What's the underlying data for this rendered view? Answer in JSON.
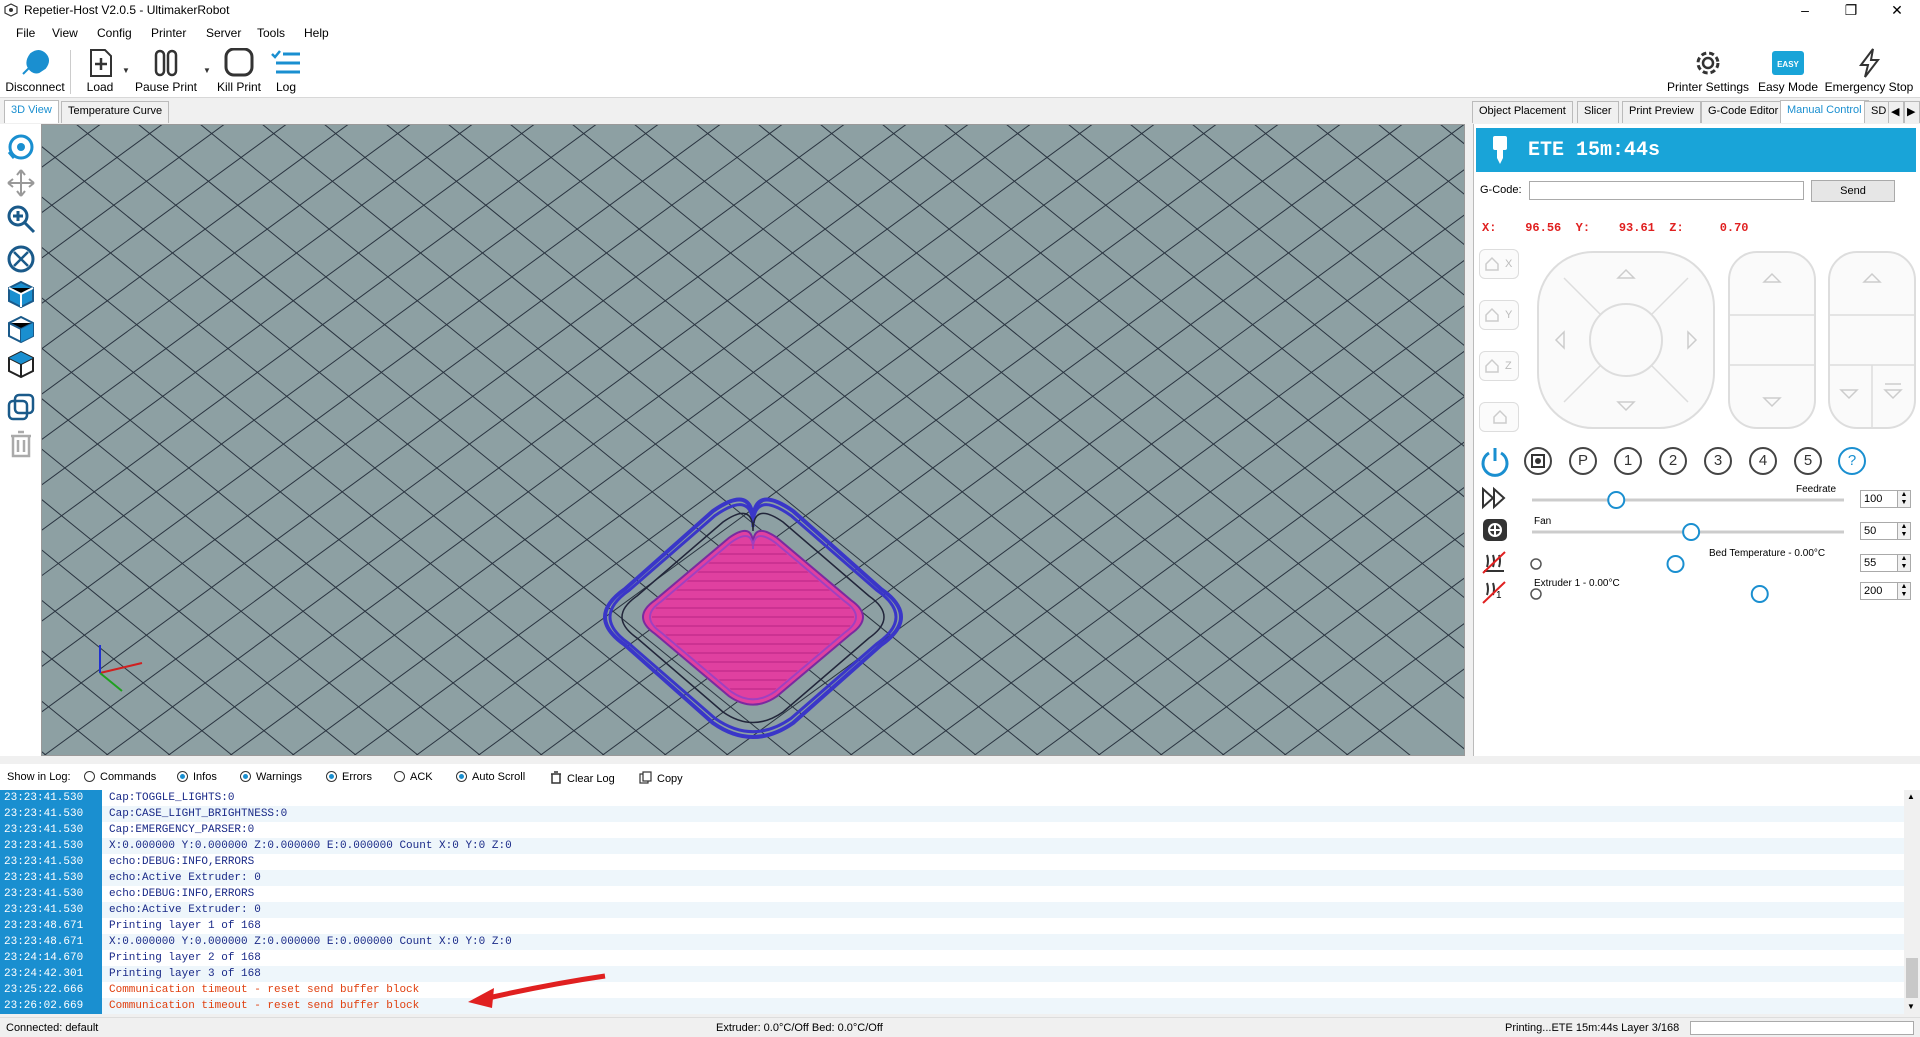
{
  "window": {
    "title": "Repetier-Host V2.0.5 - UltimakerRobot"
  },
  "menu": [
    "File",
    "View",
    "Config",
    "Printer",
    "Server",
    "Tools",
    "Help"
  ],
  "toolbar": {
    "disconnect": "Disconnect",
    "load": "Load",
    "pause": "Pause Print",
    "kill": "Kill Print",
    "log": "Log",
    "printer_settings": "Printer Settings",
    "easy_mode": "Easy Mode",
    "easy_badge": "EASY",
    "emergency_stop": "Emergency Stop"
  },
  "left_tabs": [
    "3D View",
    "Temperature Curve"
  ],
  "right_tabs": [
    "Object Placement",
    "Slicer",
    "Print Preview",
    "G-Code Editor",
    "Manual Control",
    "SD"
  ],
  "manual": {
    "ete": "ETE 15m:44s",
    "gcode_label": "G-Code:",
    "gcode_value": "",
    "send": "Send",
    "x_label": "X:",
    "x": "96.56",
    "y_label": "Y:",
    "y": "93.61",
    "z_label": "Z:",
    "z": "0.70",
    "home_labels": [
      "X",
      "Y",
      "Z",
      ""
    ],
    "buttons": [
      "P",
      "1",
      "2",
      "3",
      "4",
      "5",
      "?"
    ],
    "feedrate_label": "Feedrate",
    "feedrate_value": "100",
    "fan_label": "Fan",
    "fan_value": "50",
    "bed_label": "Bed Temperature - 0.00°C",
    "bed_value": "55",
    "extruder_label": "Extruder 1 - 0.00°C",
    "extruder_value": "200",
    "extruder_index": "1"
  },
  "sliders": {
    "feedrate": 0.27,
    "fan": 0.51,
    "bed": 0.46,
    "extruder": 0.73
  },
  "log_options": {
    "show_in_log": "Show in Log:",
    "commands": "Commands",
    "commands_on": false,
    "infos": "Infos",
    "infos_on": true,
    "warnings": "Warnings",
    "warnings_on": true,
    "errors": "Errors",
    "errors_on": true,
    "ack": "ACK",
    "ack_on": false,
    "auto_scroll": "Auto Scroll",
    "auto_scroll_on": true,
    "clear_log": "Clear Log",
    "copy": "Copy"
  },
  "log": [
    {
      "time": "23:23:41.530",
      "msg": "Cap:TOGGLE_LIGHTS:0",
      "type": "info"
    },
    {
      "time": "23:23:41.530",
      "msg": "Cap:CASE_LIGHT_BRIGHTNESS:0",
      "type": "info"
    },
    {
      "time": "23:23:41.530",
      "msg": "Cap:EMERGENCY_PARSER:0",
      "type": "info"
    },
    {
      "time": "23:23:41.530",
      "msg": "X:0.000000 Y:0.000000 Z:0.000000 E:0.000000 Count X:0 Y:0 Z:0",
      "type": "info"
    },
    {
      "time": "23:23:41.530",
      "msg": "echo:DEBUG:INFO,ERRORS",
      "type": "info"
    },
    {
      "time": "23:23:41.530",
      "msg": "echo:Active Extruder: 0",
      "type": "info"
    },
    {
      "time": "23:23:41.530",
      "msg": "echo:DEBUG:INFO,ERRORS",
      "type": "info"
    },
    {
      "time": "23:23:41.530",
      "msg": "echo:Active Extruder: 0",
      "type": "info"
    },
    {
      "time": "23:23:48.671",
      "msg": "Printing layer 1 of 168",
      "type": "info"
    },
    {
      "time": "23:23:48.671",
      "msg": "X:0.000000 Y:0.000000 Z:0.000000 E:0.000000 Count X:0 Y:0 Z:0",
      "type": "info"
    },
    {
      "time": "23:24:14.670",
      "msg": "Printing layer 2 of 168",
      "type": "info"
    },
    {
      "time": "23:24:42.301",
      "msg": "Printing layer 3 of 168",
      "type": "info"
    },
    {
      "time": "23:25:22.666",
      "msg": "Communication timeout - reset send buffer block",
      "type": "error"
    },
    {
      "time": "23:26:02.669",
      "msg": "Communication timeout - reset send buffer block",
      "type": "error"
    }
  ],
  "status": {
    "connected": "Connected: default",
    "temps": "Extruder: 0.0°C/Off Bed: 0.0°C/Off",
    "printing": "Printing...ETE 15m:44s Layer 3/168"
  },
  "colors": {
    "accent": "#1a8fd0",
    "ete_bg": "#19a4d8",
    "error": "#e04010",
    "coords": "#e02020",
    "bed": "#8da0a3",
    "skirt": "#3a36c8",
    "part": "#e040a0"
  }
}
